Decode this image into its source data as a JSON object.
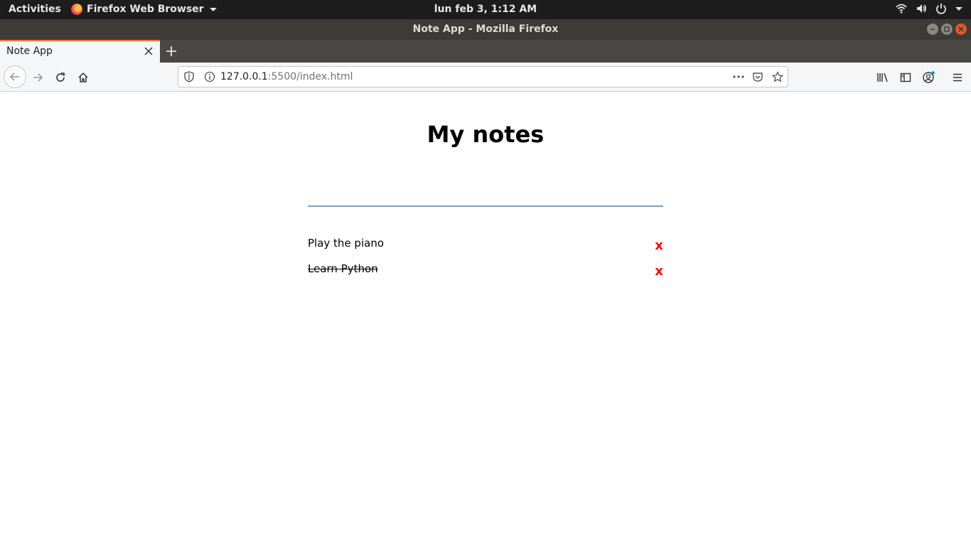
{
  "os": {
    "activities": "Activities",
    "app_menu": "Firefox Web Browser",
    "clock": "lun feb  3,  1:12 AM"
  },
  "window": {
    "title": "Note App - Mozilla Firefox"
  },
  "browser": {
    "tab": {
      "label": "Note App"
    },
    "url": {
      "host": "127.0.0.1",
      "rest": ":5500/index.html"
    }
  },
  "page": {
    "heading": "My notes",
    "input": {
      "value": "",
      "placeholder": ""
    },
    "notes": [
      {
        "text": "Play the piano",
        "completed": false,
        "delete_label": "x"
      },
      {
        "text": "Learn Python",
        "completed": true,
        "delete_label": "x"
      }
    ]
  },
  "colors": {
    "accent_tab": "#ff7139",
    "delete": "#ff0000",
    "input_underline": "#7aa4c5"
  }
}
